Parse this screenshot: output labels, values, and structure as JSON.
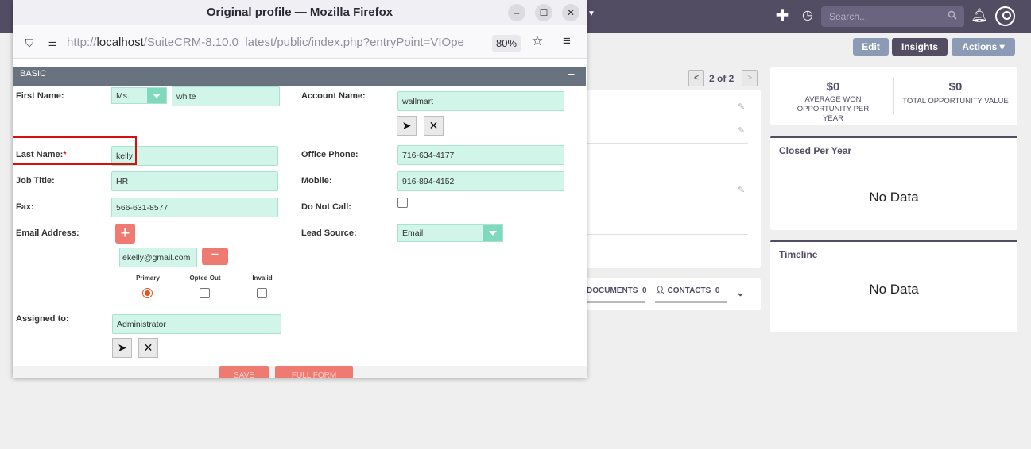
{
  "app": {
    "search_placeholder": "Search...",
    "header_buttons": {
      "edit": "Edit",
      "insights": "Insights",
      "actions": "Actions"
    },
    "pager_text": "2 of 2",
    "tabs": {
      "documents": "DOCUMENTS",
      "documents_count": "0",
      "contacts": "CONTACTS",
      "contacts_count": "0"
    },
    "stats": {
      "won_amount": "$0",
      "won_label": "AVERAGE WON OPPORTUNITY PER YEAR",
      "total_amount": "$0",
      "total_label": "TOTAL OPPORTUNITY VALUE"
    },
    "closed_card": {
      "title": "Closed Per Year",
      "empty": "No Data"
    },
    "timeline_card": {
      "title": "Timeline",
      "empty": "No Data"
    },
    "colors": {
      "nav": "#534d64",
      "accent_red": "#ee7a72",
      "input_bg": "#d2f5ea"
    }
  },
  "popup": {
    "window_title": "Original profile — Mozilla Firefox",
    "url_prefix": "http://",
    "url_host": "localhost",
    "url_rest": "/SuiteCRM-8.10.0_latest/public/index.php?entryPoint=VIOpe",
    "zoom": "80%",
    "panel": {
      "label": "BASIC",
      "collapse": "–"
    },
    "fields": {
      "first_name_label": "First Name:",
      "salutation": "Ms.",
      "first_name": "white",
      "account_name_label": "Account Name:",
      "account_name": "wallmart",
      "last_name_label": "Last Name:",
      "required_mark": "*",
      "last_name": "kelly",
      "office_phone_label": "Office Phone:",
      "office_phone": "716-634-4177",
      "job_title_label": "Job Title:",
      "job_title": "HR",
      "mobile_label": "Mobile:",
      "mobile": "916-894-4152",
      "fax_label": "Fax:",
      "fax": "566-631-8577",
      "do_not_call_label": "Do Not Call:",
      "email_label": "Email Address:",
      "email": "ekelly@gmail.com",
      "email_flags": {
        "primary": "Primary",
        "opted_out": "Opted Out",
        "invalid": "Invalid"
      },
      "lead_source_label": "Lead Source:",
      "lead_source": "Email",
      "assigned_label": "Assigned to:",
      "assigned": "Administrator"
    },
    "buttons": {
      "save": "SAVE",
      "full_form": "FULL FORM"
    }
  }
}
